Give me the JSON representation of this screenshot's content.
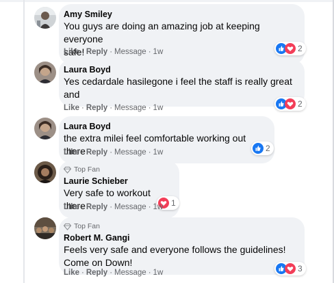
{
  "colors": {
    "bubble": "#f0f2f5",
    "like_blue": "#1877f2",
    "love_red": "#f33e58",
    "meta_gray": "#65676b"
  },
  "comments": [
    {
      "author": "Amy Smiley",
      "text_lines": [
        "You guys are doing an amazing job at keeping everyone",
        "safe!"
      ],
      "actions": {
        "like": "Like",
        "reply": "Reply",
        "message": "Message",
        "time": "1w"
      },
      "reactions": {
        "icons": [
          "like-icon",
          "love-icon"
        ],
        "count": "2"
      }
    },
    {
      "author": "Laura Boyd",
      "text_lines": [
        "Yes cedardale hasilegone i feel the staff is really great",
        "and"
      ],
      "actions": {
        "like": "Like",
        "reply": "Reply",
        "message": "Message",
        "time": "1w"
      },
      "reactions": {
        "icons": [
          "like-icon",
          "love-icon"
        ],
        "count": "2"
      }
    },
    {
      "author": "Laura Boyd",
      "text_lines": [
        "the extra milei feel comfortable working out there"
      ],
      "actions": {
        "like": "Like",
        "reply": "Reply",
        "message": "Message",
        "time": "1w"
      },
      "reactions": {
        "icons": [
          "like-icon"
        ],
        "count": "2"
      }
    },
    {
      "badge": "Top Fan",
      "author": "Laurie Schieber",
      "text_lines": [
        "Very safe to workout there"
      ],
      "actions": {
        "like": "Like",
        "reply": "Reply",
        "message": "Message",
        "time": "1w"
      },
      "reactions": {
        "icons": [
          "love-icon"
        ],
        "count": "1"
      }
    },
    {
      "badge": "Top Fan",
      "author": "Robert M. Gangi",
      "text_lines": [
        "Feels very safe and everyone follows the guidelines!",
        "Come on Down!"
      ],
      "actions": {
        "like": "Like",
        "reply": "Reply",
        "message": "Message",
        "time": "1w"
      },
      "reactions": {
        "icons": [
          "like-icon",
          "love-icon"
        ],
        "count": "3"
      }
    }
  ]
}
